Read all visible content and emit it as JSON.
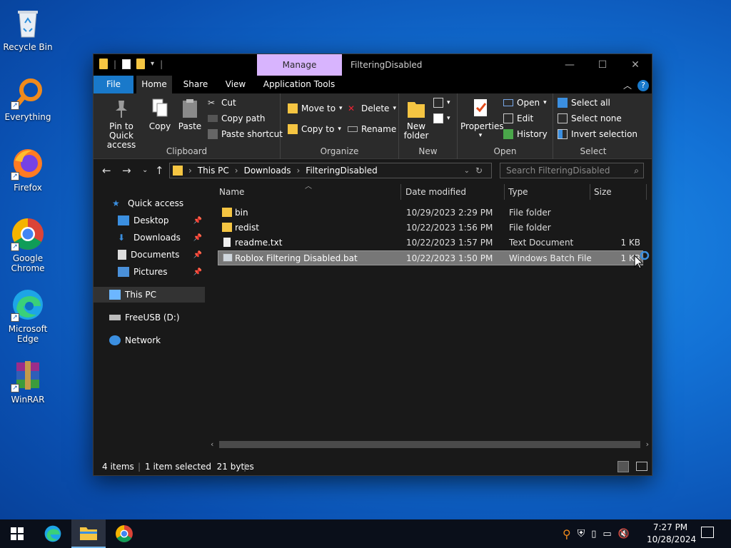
{
  "desktop": {
    "icons": [
      {
        "label": "Recycle Bin",
        "icon": "recycle-bin-icon"
      },
      {
        "label": "Everything",
        "icon": "search-magnifier-icon"
      },
      {
        "label": "Firefox",
        "icon": "firefox-icon"
      },
      {
        "label": "Google Chrome",
        "icon": "chrome-icon"
      },
      {
        "label": "Microsoft Edge",
        "icon": "edge-icon"
      },
      {
        "label": "WinRAR",
        "icon": "winrar-icon"
      }
    ]
  },
  "window": {
    "title": "FilteringDisabled",
    "manage_tab": "Manage",
    "ribbon_tabs": [
      "File",
      "Home",
      "Share",
      "View",
      "Application Tools"
    ],
    "clipboard": {
      "pin": "Pin to Quick access",
      "copy": "Copy",
      "paste": "Paste",
      "cut": "Cut",
      "copy_path": "Copy path",
      "paste_shortcut": "Paste shortcut",
      "label": "Clipboard"
    },
    "organize": {
      "move_to": "Move to",
      "copy_to": "Copy to",
      "delete": "Delete",
      "rename": "Rename",
      "label": "Organize"
    },
    "new": {
      "new_folder": "New folder",
      "label": "New"
    },
    "open": {
      "properties": "Properties",
      "open": "Open",
      "edit": "Edit",
      "history": "History",
      "label": "Open"
    },
    "select": {
      "select_all": "Select all",
      "select_none": "Select none",
      "invert": "Invert selection",
      "label": "Select"
    },
    "address": {
      "segments": [
        "This PC",
        "Downloads",
        "FilteringDisabled"
      ],
      "search_placeholder": "Search FilteringDisabled"
    },
    "nav": {
      "quick_access": "Quick access",
      "desktop": "Desktop",
      "downloads": "Downloads",
      "documents": "Documents",
      "pictures": "Pictures",
      "this_pc": "This PC",
      "usb": "FreeUSB (D:)",
      "network": "Network"
    },
    "columns": {
      "name": "Name",
      "date": "Date modified",
      "type": "Type",
      "size": "Size"
    },
    "files": [
      {
        "name": "bin",
        "date": "10/29/2023 2:29 PM",
        "type": "File folder",
        "size": "",
        "icon": "folder-icon"
      },
      {
        "name": "redist",
        "date": "10/22/2023 1:56 PM",
        "type": "File folder",
        "size": "",
        "icon": "folder-icon"
      },
      {
        "name": "readme.txt",
        "date": "10/22/2023 1:57 PM",
        "type": "Text Document",
        "size": "1 KB",
        "icon": "text-file-icon"
      },
      {
        "name": "Roblox Filtering Disabled.bat",
        "date": "10/22/2023 1:50 PM",
        "type": "Windows Batch File",
        "size": "1 KB",
        "icon": "batch-file-icon"
      }
    ],
    "status": {
      "count": "4 items",
      "selected": "1 item selected  21 bytes"
    }
  },
  "taskbar": {
    "time": "7:27 PM",
    "date": "10/28/2024"
  }
}
